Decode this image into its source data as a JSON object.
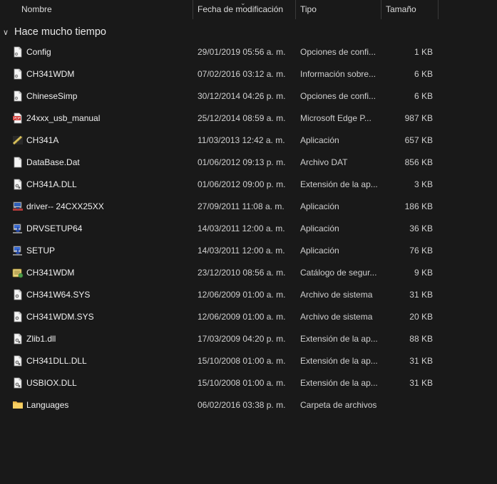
{
  "columns": {
    "name": "Nombre",
    "date": "Fecha de modificación",
    "type": "Tipo",
    "size": "Tamaño"
  },
  "group": {
    "label": "Hace mucho tiempo"
  },
  "files": [
    {
      "name": "Config",
      "date": "29/01/2019 05:56 a. m.",
      "type": "Opciones de confi...",
      "size": "1 KB",
      "icon": "settings-file-icon"
    },
    {
      "name": "CH341WDM",
      "date": "07/02/2016 03:12 a. m.",
      "type": "Información sobre...",
      "size": "6 KB",
      "icon": "settings-file-icon"
    },
    {
      "name": "ChineseSimp",
      "date": "30/12/2014 04:26 p. m.",
      "type": "Opciones de confi...",
      "size": "6 KB",
      "icon": "settings-file-icon"
    },
    {
      "name": "24xxx_usb_manual",
      "date": "25/12/2014 08:59 a. m.",
      "type": "Microsoft Edge P...",
      "size": "987 KB",
      "icon": "pdf-file-icon"
    },
    {
      "name": "CH341A",
      "date": "11/03/2013 12:42 a. m.",
      "type": "Aplicación",
      "size": "657 KB",
      "icon": "chip-app-icon"
    },
    {
      "name": "DataBase.Dat",
      "date": "01/06/2012 09:13 p. m.",
      "type": "Archivo DAT",
      "size": "856 KB",
      "icon": "blank-file-icon"
    },
    {
      "name": "CH341A.DLL",
      "date": "01/06/2012 09:00 p. m.",
      "type": "Extensión de la ap...",
      "size": "3 KB",
      "icon": "dll-file-icon"
    },
    {
      "name": "driver-- 24CXX25XX",
      "date": "27/09/2011 11:08 a. m.",
      "type": "Aplicación",
      "size": "186 KB",
      "icon": "installer-app-icon"
    },
    {
      "name": "DRVSETUP64",
      "date": "14/03/2011 12:00 a. m.",
      "type": "Aplicación",
      "size": "36 KB",
      "icon": "setup-app-icon"
    },
    {
      "name": "SETUP",
      "date": "14/03/2011 12:00 a. m.",
      "type": "Aplicación",
      "size": "76 KB",
      "icon": "setup-app-icon"
    },
    {
      "name": "CH341WDM",
      "date": "23/12/2010 08:56 a. m.",
      "type": "Catálogo de segur...",
      "size": "9 KB",
      "icon": "security-catalog-icon"
    },
    {
      "name": "CH341W64.SYS",
      "date": "12/06/2009 01:00 a. m.",
      "type": "Archivo de sistema",
      "size": "31 KB",
      "icon": "system-file-icon"
    },
    {
      "name": "CH341WDM.SYS",
      "date": "12/06/2009 01:00 a. m.",
      "type": "Archivo de sistema",
      "size": "20 KB",
      "icon": "system-file-icon"
    },
    {
      "name": "Zlib1.dll",
      "date": "17/03/2009 04:20 p. m.",
      "type": "Extensión de la ap...",
      "size": "88 KB",
      "icon": "dll-file-icon"
    },
    {
      "name": "CH341DLL.DLL",
      "date": "15/10/2008 01:00 a. m.",
      "type": "Extensión de la ap...",
      "size": "31 KB",
      "icon": "dll-file-icon"
    },
    {
      "name": "USBIOX.DLL",
      "date": "15/10/2008 01:00 a. m.",
      "type": "Extensión de la ap...",
      "size": "31 KB",
      "icon": "dll-file-icon"
    },
    {
      "name": "Languages",
      "date": "06/02/2016 03:38 p. m.",
      "type": "Carpeta de archivos",
      "size": "",
      "icon": "folder-icon"
    }
  ]
}
